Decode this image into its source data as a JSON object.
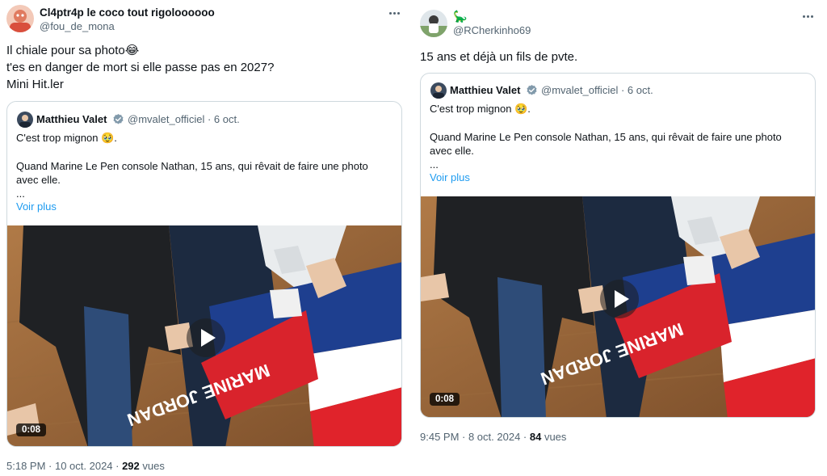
{
  "colors": {
    "accent_link": "#1d9bf0",
    "verified": "#829aab",
    "muted": "#536471",
    "text": "#0f1419",
    "border": "#cfd9de"
  },
  "left_tweet": {
    "author_name": "Cl4ptr4p le coco tout rigoloooooo",
    "author_handle": "@fou_de_mona",
    "more_icon": "more-horizontal-icon",
    "text_lines": [
      "Il chiale pour sa photo😂",
      "t'es en danger de mort si elle passe pas en 2027?",
      "Mini Hit.ler"
    ],
    "quote": {
      "name": "Matthieu Valet",
      "handle_date": "@mvalet_officiel · 6 oct.",
      "line1": "C'est trop mignon 🥹.",
      "line2": "Quand Marine Le Pen console Nathan, 15 ans, qui rêvait de faire une photo",
      "line3": "avec elle.",
      "line4": "...",
      "show_more": "Voir plus",
      "flag_text": "MARINE JORDAN",
      "duration": "0:08"
    },
    "time": "5:18 PM · 10 oct. 2024 · ",
    "views_count": "292",
    "views_label": " vues"
  },
  "right_tweet": {
    "author_name": "🦕",
    "author_handle": "@RCherkinho69",
    "more_icon": "more-horizontal-icon",
    "text": "15 ans et déjà un fils de pvte.",
    "quote": {
      "name": "Matthieu Valet",
      "handle_date": "@mvalet_officiel · 6 oct.",
      "line1": "C'est trop mignon 🥹.",
      "line2": "Quand Marine Le Pen console Nathan, 15 ans, qui rêvait de faire une photo",
      "line3": "avec elle.",
      "line4": "...",
      "show_more": "Voir plus",
      "flag_text": "MARINE JORDAN",
      "duration": "0:08"
    },
    "time": "9:45 PM · 8 oct. 2024 · ",
    "views_count": "84",
    "views_label": " vues"
  }
}
